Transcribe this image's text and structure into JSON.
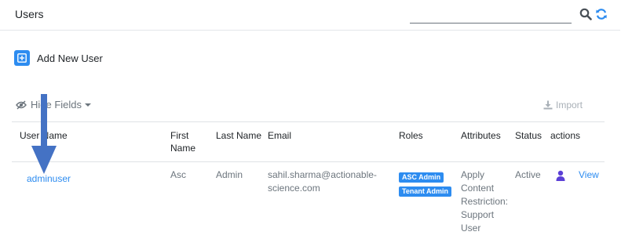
{
  "header": {
    "title": "Users",
    "search_placeholder": "",
    "icons": {
      "search": "search-icon",
      "refresh": "refresh-icon"
    }
  },
  "toolbar": {
    "add_user_label": "Add New User",
    "hide_fields_label": "Hide Fields",
    "import_label": "Import"
  },
  "table": {
    "columns": {
      "user_name": "User Name",
      "first_name": "First Name",
      "last_name": "Last Name",
      "email": "Email",
      "roles": "Roles",
      "attributes": "Attributes",
      "status": "Status",
      "actions": "actions"
    },
    "rows": [
      {
        "user_name": "adminuser",
        "first_name": "Asc",
        "last_name": "Admin",
        "email": "sahil.sharma@actionable-science.com",
        "roles": [
          "ASC Admin",
          "Tenant Admin"
        ],
        "attributes": "Apply Content Restriction: Support User",
        "status": "Active",
        "view_label": "View"
      }
    ]
  },
  "colors": {
    "accent": "#2d8cf0",
    "person_icon": "#5b3fd6",
    "annotation_arrow": "#4472c4"
  }
}
